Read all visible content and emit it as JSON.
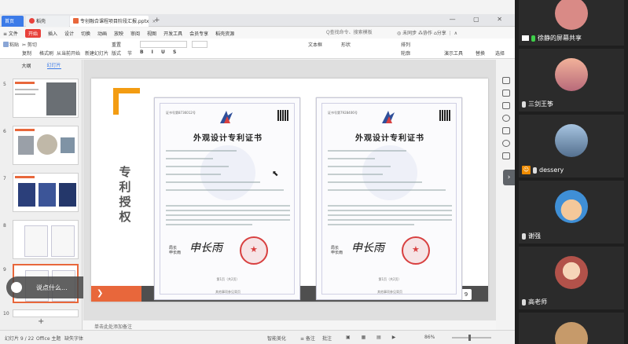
{
  "tabs": {
    "home": "首页",
    "doc1": "稻壳",
    "doc2": "专创融合课程项目阶段汇报.pptx",
    "close": "×",
    "add": "+"
  },
  "window_controls": "— ▢ ✕",
  "menu": {
    "hamburger": "≡ 文件",
    "items": [
      "开始",
      "插入",
      "设计",
      "切换",
      "动画",
      "放映",
      "审阅",
      "视图",
      "开发工具",
      "会员专享",
      "稻壳资源"
    ],
    "active": "开始"
  },
  "search": {
    "placeholder": "Q查找命令、搜索模板"
  },
  "topright": "◎ 未同步  ⁂协作  ⌂分享  ⋮  ∧",
  "ribbon": {
    "paste": "粘贴",
    "cut": "✂ 剪切",
    "copy": "复制",
    "format_painter": "格式刷",
    "from_current": "从当前开始",
    "new_slide": "新建幻灯片",
    "layout": "版式",
    "section": "节",
    "reset": "重置",
    "font_placeholder": "",
    "text_tools": "文本框",
    "shape": "形状",
    "arrange": "排列",
    "outline": "轮廓",
    "show_tools": "演示工具",
    "replace": "替换",
    "select": "选择"
  },
  "left_panel": {
    "tab_outline": "大纲",
    "tab_slides": "幻灯片",
    "slide_numbers": [
      "5",
      "6",
      "7",
      "8",
      "9",
      "10"
    ]
  },
  "chat_bubble": {
    "label": "说点什么...",
    "arrow": "‹"
  },
  "add_slide": "+",
  "slide": {
    "vertical_title": "专利授权",
    "page_number": "9",
    "certificates": [
      {
        "title": "外观设计专利证书",
        "patent_no": "证书号第8736012号",
        "director_label": "局长\n申长雨",
        "signature": "申长雨",
        "page": "第1页（共2页）",
        "footer": "其他事项参见背页"
      },
      {
        "title": "外观设计专利证书",
        "patent_no": "证书号第7928406号",
        "director_label": "局长\n申长雨",
        "signature": "申长雨",
        "page": "第1页（共2页）",
        "footer": "其他事项参见背页"
      }
    ]
  },
  "notes": "单击此处添加备注",
  "status": {
    "slide_info": "幻灯片 9 / 22",
    "theme": "Office 主题",
    "missing_font": "缺失字体",
    "smart_beautify": "智能美化",
    "notes": "≡ 备注",
    "comments": "批注",
    "zoom": "86%"
  },
  "meeting": {
    "participants": [
      {
        "name": "徐静的屏幕共享",
        "avatar_color": "#d98a86"
      },
      {
        "name": "三剑王筝",
        "avatar_color": "#e58a7a"
      },
      {
        "name": "dessery",
        "avatar_color": "#7aa0c8"
      },
      {
        "name": "谢强",
        "avatar_color": "#3f8fd6"
      },
      {
        "name": "高老师",
        "avatar_color": "#b2524a"
      },
      {
        "name": "",
        "avatar_color": "#c69a6a"
      }
    ],
    "collapse": "›"
  },
  "colors": {
    "accent": "#e8673b",
    "wps_red": "#e8413b",
    "bracket": "#f39c12",
    "mic_on": "#3ecf4a"
  }
}
